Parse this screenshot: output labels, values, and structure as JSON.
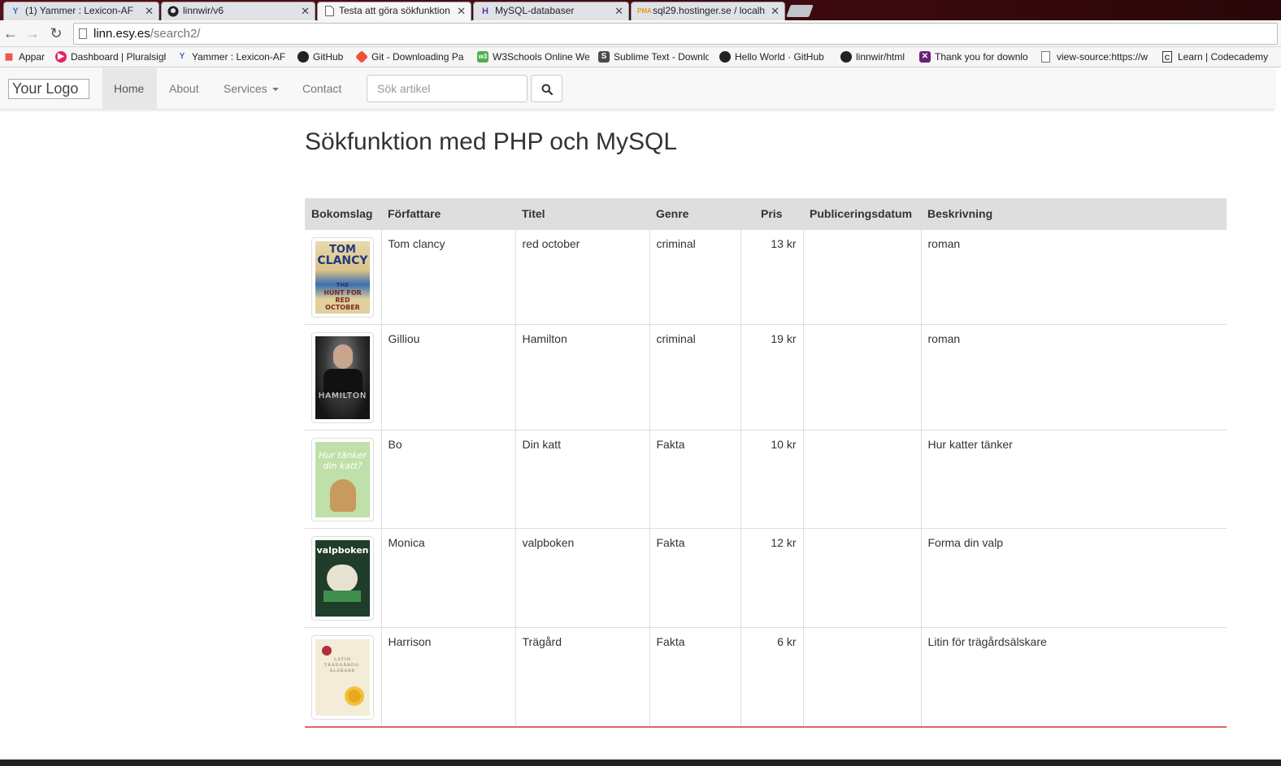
{
  "browser": {
    "tabs": [
      {
        "title": "(1) Yammer : Lexicon-AF",
        "icon": "yammer-icon",
        "active": false
      },
      {
        "title": "linnwir/v6",
        "icon": "github-icon",
        "active": false
      },
      {
        "title": "Testa att göra sökfunktion",
        "icon": "page-icon",
        "active": true
      },
      {
        "title": "MySQL-databaser",
        "icon": "hostinger-icon",
        "active": false
      },
      {
        "title": "sql29.hostinger.se / localh",
        "icon": "phpmyadmin-icon",
        "active": false
      }
    ],
    "url_host": "linn.esy.es",
    "url_path": "/search2/",
    "bookmarks": [
      "Appar",
      "Dashboard | Pluralsigh",
      "Yammer : Lexicon-AF",
      "GitHub",
      "Git - Downloading Pa",
      "W3Schools Online We",
      "Sublime Text - Downlo",
      "Hello World · GitHub",
      "linnwir/html",
      "Thank you for downlo",
      "view-source:https://w",
      "Learn | Codecademy"
    ]
  },
  "site_nav": {
    "logo_alt": "Your Logo",
    "items": {
      "home": "Home",
      "about": "About",
      "services": "Services",
      "contact": "Contact"
    },
    "search_placeholder": "Sök artikel"
  },
  "page": {
    "title": "Sökfunktion med PHP och MySQL"
  },
  "table": {
    "headers": [
      "Bokomslag",
      "Författare",
      "Titel",
      "Genre",
      "Pris",
      "Publiceringsdatum",
      "Beskrivning"
    ],
    "rows": [
      {
        "author": "Tom clancy",
        "title": "red october",
        "genre": "criminal",
        "price": "13 kr",
        "published": "",
        "description": "roman",
        "cover": {
          "lines": [
            "TOM",
            "CLANCY",
            "THE",
            "HUNT FOR RED",
            "OCTOBER"
          ]
        }
      },
      {
        "author": "Gilliou",
        "title": "Hamilton",
        "genre": "criminal",
        "price": "19 kr",
        "published": "",
        "description": "roman",
        "cover": {
          "lines": [
            "HAMILTON"
          ]
        }
      },
      {
        "author": "Bo",
        "title": "Din katt",
        "genre": "Fakta",
        "price": "10 kr",
        "published": "",
        "description": "Hur katter tänker",
        "cover": {
          "lines": [
            "Hur tänker",
            "din katt?"
          ]
        }
      },
      {
        "author": "Monica",
        "title": "valpboken",
        "genre": "Fakta",
        "price": "12 kr",
        "published": "",
        "description": "Forma din valp",
        "cover": {
          "lines": [
            "valpboken"
          ]
        }
      },
      {
        "author": "Harrison",
        "title": "Trägård",
        "genre": "Fakta",
        "price": "6 kr",
        "published": "",
        "description": "Litin för trägårdsälskare",
        "cover": {
          "lines": [
            "LATIN",
            "TRÄDGÅRDS-",
            "ÄLSKARE"
          ]
        }
      }
    ]
  }
}
